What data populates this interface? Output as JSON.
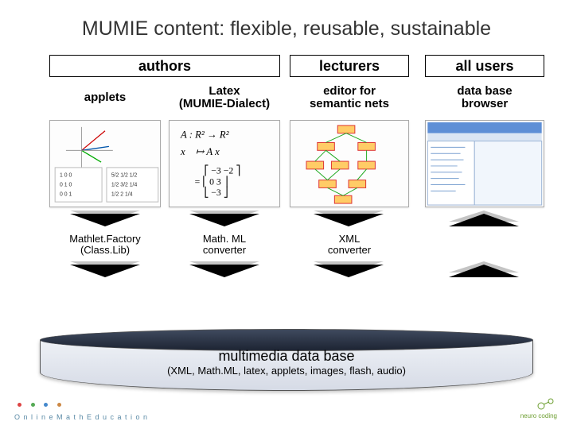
{
  "title": "MUMIE content: flexible, reusable, sustainable",
  "headers": {
    "authors": "authors",
    "lecturers": "lecturers",
    "users": "all users"
  },
  "columns": {
    "applets": {
      "label": "applets",
      "converter_l1": "Mathlet.Factory",
      "converter_l2": "(Class.Lib)"
    },
    "latex": {
      "label_l1": "Latex",
      "label_l2": "(MUMIE-Dialect)",
      "converter_l1": "Math. ML",
      "converter_l2": "converter"
    },
    "editor": {
      "label_l1": "editor for",
      "label_l2": "semantic nets",
      "converter_l1": "XML",
      "converter_l2": "converter"
    },
    "browser": {
      "label_l1": "data base",
      "label_l2": "browser"
    }
  },
  "database": {
    "title": "multimedia data base",
    "subtitle": "(XML, Math.ML, latex, applets, images, flash, audio)"
  },
  "footer": {
    "left": "O n l i n e   M a t h   E d u c a t i o n",
    "right": "neuro coding"
  }
}
